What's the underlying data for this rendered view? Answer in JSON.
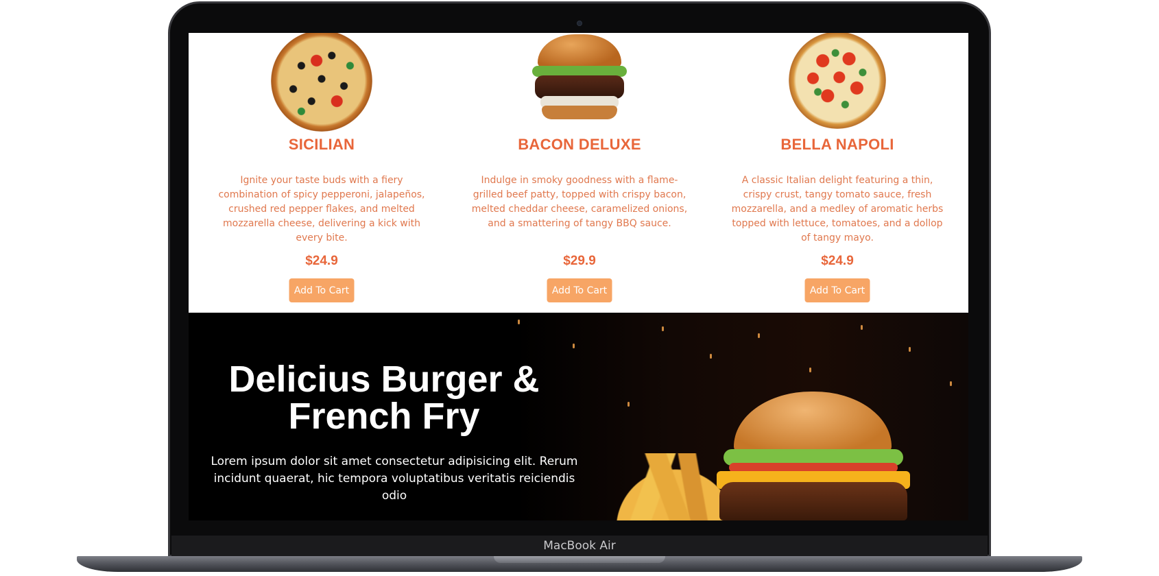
{
  "device": {
    "label": "MacBook Air"
  },
  "menu": {
    "products": [
      {
        "name": "SICILIAN",
        "description": "Ignite your taste buds with a fiery combination of spicy pepperoni, jalapeños, crushed red pepper flakes, and melted mozzarella cheese, delivering a kick with every bite.",
        "price": "$24.9",
        "button_label": "Add To Cart"
      },
      {
        "name": "BACON DELUXE",
        "description": "Indulge in smoky goodness with a flame-grilled beef patty, topped with crispy bacon, melted cheddar cheese, caramelized onions, and a smattering of tangy BBQ sauce.",
        "price": "$29.9",
        "button_label": "Add To Cart"
      },
      {
        "name": "BELLA NAPOLI",
        "description": "A classic Italian delight featuring a thin, crispy crust, tangy tomato sauce, fresh mozzarella, and a medley of aromatic herbs topped with lettuce, tomatoes, and a dollop of tangy mayo.",
        "price": "$24.9",
        "button_label": "Add To Cart"
      }
    ]
  },
  "hero": {
    "title": "Delicius Burger & French Fry",
    "text": "Lorem ipsum dolor sit amet consectetur adipisicing elit. Rerum incidunt quaerat, hic tempora voluptatibus veritatis reiciendis odio"
  },
  "colors": {
    "accent": "#e8663a",
    "button": "#f7a565",
    "hero_background": "#000000"
  }
}
